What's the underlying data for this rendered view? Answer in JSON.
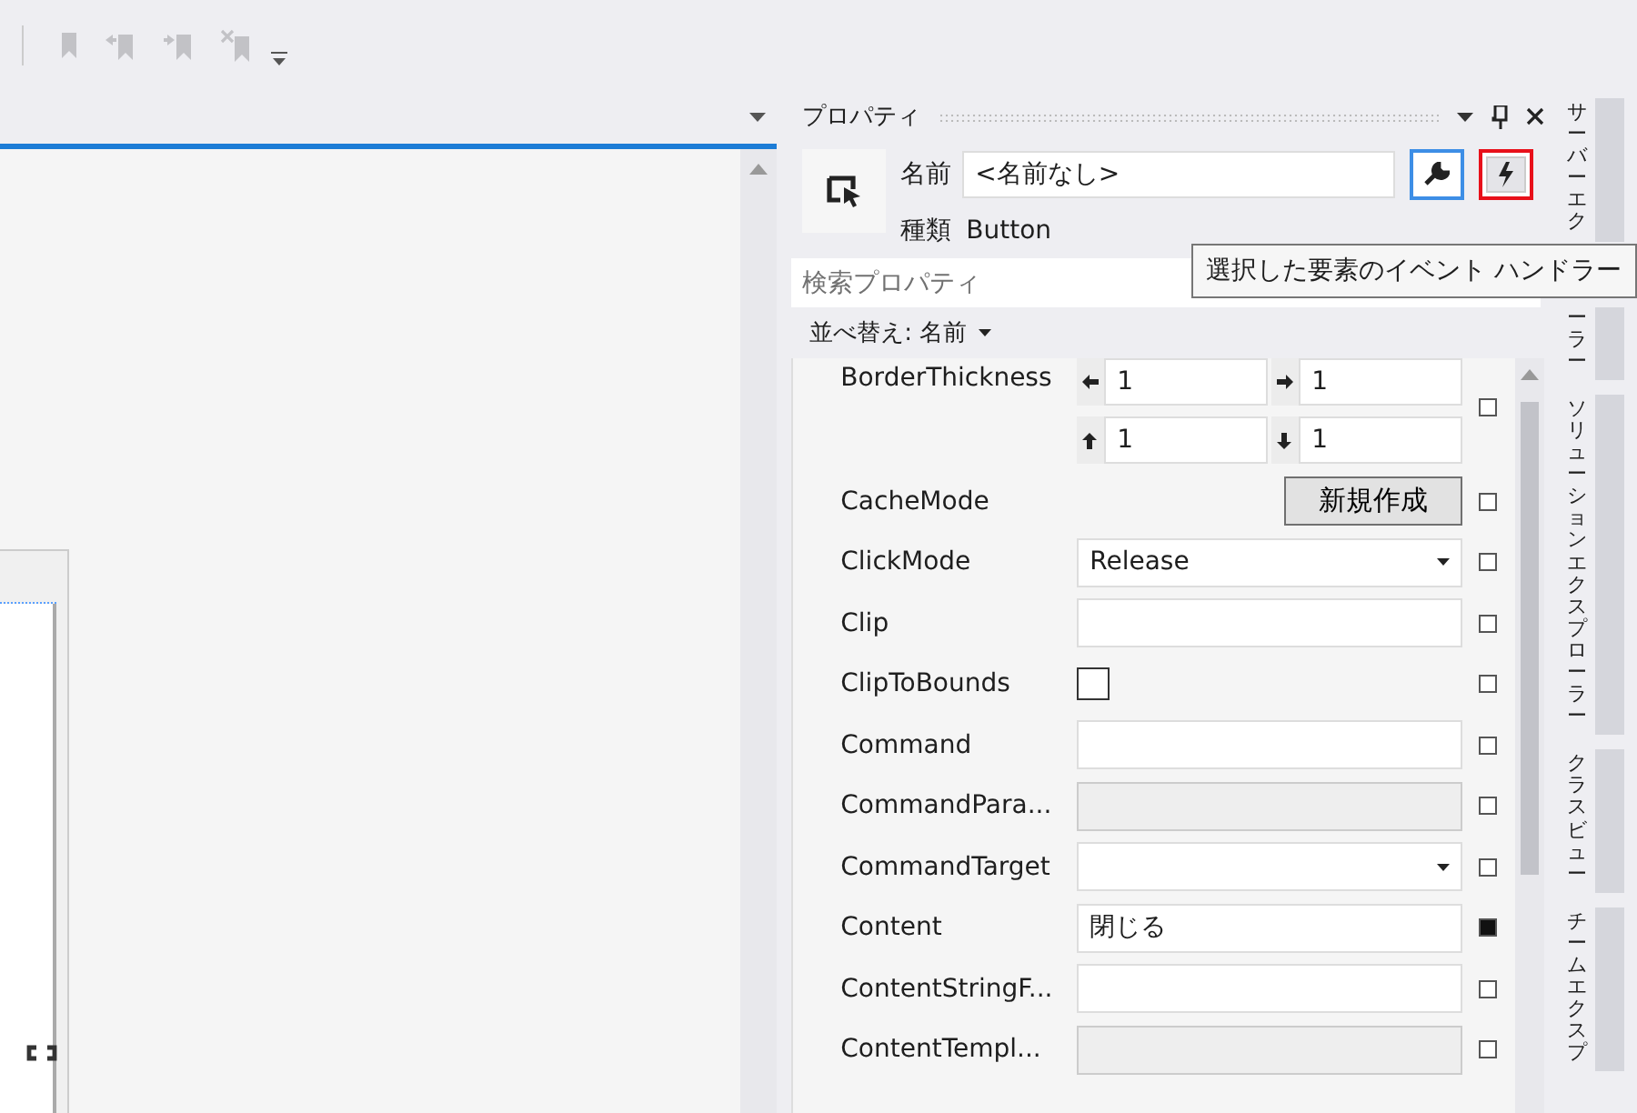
{
  "properties_panel": {
    "title": "プロパティ",
    "name_label": "名前",
    "name_value": "<名前なし>",
    "type_label": "種類",
    "type_value": "Button",
    "view_buttons": [
      {
        "kind": "properties",
        "selected": true,
        "highlighted": false
      },
      {
        "kind": "events",
        "selected": false,
        "highlighted": true
      }
    ],
    "tooltip": "選択した要素のイベント ハンドラー",
    "search": {
      "placeholder": "検索プロパティ"
    },
    "sort": {
      "label": "並べ替え: 名前"
    },
    "properties": [
      {
        "name": "BorderThickness",
        "kind": "thickness",
        "values": [
          "1",
          "1",
          "1",
          "1"
        ],
        "set": false
      },
      {
        "name": "CacheMode",
        "kind": "button",
        "value": "新規作成",
        "set": false
      },
      {
        "name": "ClickMode",
        "kind": "dropdown",
        "value": "Release",
        "set": false
      },
      {
        "name": "Clip",
        "kind": "text",
        "disabled": false,
        "set": false
      },
      {
        "name": "ClipToBounds",
        "kind": "checkbox",
        "checked": false,
        "set": false
      },
      {
        "name": "Command",
        "kind": "text",
        "disabled": false,
        "set": false
      },
      {
        "name": "CommandPara...",
        "kind": "text",
        "disabled": true,
        "set": false
      },
      {
        "name": "CommandTarget",
        "kind": "dropdown",
        "set": false
      },
      {
        "name": "Content",
        "kind": "text",
        "value": "閉じる",
        "disabled": false,
        "set": true
      },
      {
        "name": "ContentStringF...",
        "kind": "text",
        "disabled": false,
        "set": false
      },
      {
        "name": "ContentTempl...",
        "kind": "text",
        "disabled": true,
        "set": false
      }
    ]
  },
  "side_tabs": [
    {
      "parts": [
        "サーバーエク",
        "ーラー"
      ]
    },
    {
      "parts": [
        "ソリューションエクスプローラー"
      ]
    },
    {
      "parts": [
        "クラスビュー"
      ]
    },
    {
      "parts": [
        "チームエクスプ"
      ]
    }
  ]
}
